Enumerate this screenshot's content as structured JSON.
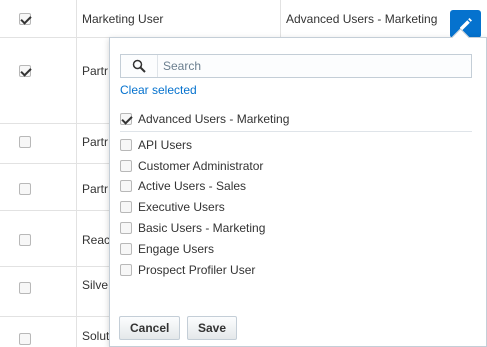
{
  "table": {
    "rows": [
      {
        "checked": true,
        "name": "Marketing User",
        "groups": "Advanced Users - Marketing"
      },
      {
        "checked": true,
        "name": "Partr"
      },
      {
        "checked": false,
        "name": "Partr"
      },
      {
        "checked": false,
        "name": "Partr"
      },
      {
        "checked": false,
        "name": "Reac"
      },
      {
        "checked": false,
        "name": "Silve"
      },
      {
        "checked": false,
        "name": "Solut"
      }
    ]
  },
  "popup": {
    "search": {
      "placeholder": "Search",
      "value": ""
    },
    "clear_label": "Clear selected",
    "selected": [
      {
        "label": "Advanced Users - Marketing",
        "checked": true
      }
    ],
    "options": [
      {
        "label": "API Users",
        "checked": false
      },
      {
        "label": "Customer Administrator",
        "checked": false
      },
      {
        "label": "Active Users - Sales",
        "checked": false
      },
      {
        "label": "Executive Users",
        "checked": false
      },
      {
        "label": "Basic Users - Marketing",
        "checked": false
      },
      {
        "label": "Engage Users",
        "checked": false
      },
      {
        "label": "Prospect Profiler User",
        "checked": false
      }
    ],
    "cancel_label": "Cancel",
    "save_label": "Save"
  },
  "colors": {
    "accent": "#0572ce",
    "border": "#e2e2e2"
  }
}
